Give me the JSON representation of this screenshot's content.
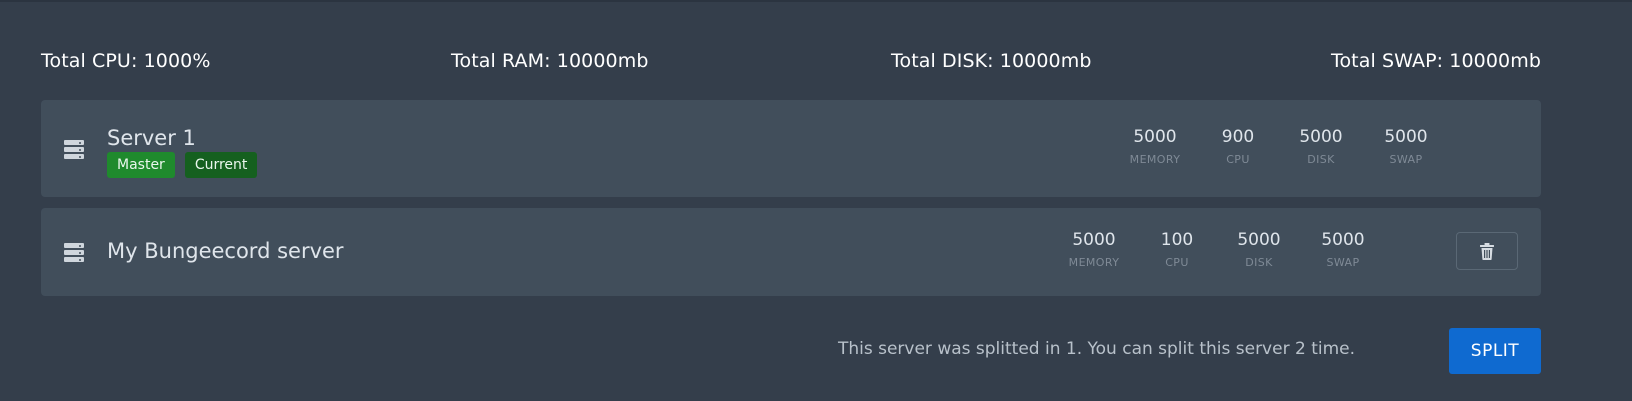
{
  "totals": {
    "cpu": "Total CPU: 1000%",
    "ram": "Total RAM: 10000mb",
    "disk": "Total DISK: 10000mb",
    "swap": "Total SWAP: 10000mb"
  },
  "servers": [
    {
      "name": "Server 1",
      "icon": "server-icon",
      "badges": {
        "master": "Master",
        "current": "Current"
      },
      "stats": [
        {
          "value": "5000",
          "label": "MEMORY"
        },
        {
          "value": "900",
          "label": "CPU"
        },
        {
          "value": "5000",
          "label": "DISK"
        },
        {
          "value": "5000",
          "label": "SWAP"
        }
      ]
    },
    {
      "name": "My Bungeecord server",
      "icon": "server-icon",
      "stats": [
        {
          "value": "5000",
          "label": "MEMORY"
        },
        {
          "value": "100",
          "label": "CPU"
        },
        {
          "value": "5000",
          "label": "DISK"
        },
        {
          "value": "5000",
          "label": "SWAP"
        }
      ],
      "delete_icon": "trash-icon"
    }
  ],
  "footer": {
    "split_text": "This server was splitted in 1. You can split this server 2 time.",
    "split_button": "SPLIT"
  },
  "colors": {
    "background": "#343e4b",
    "card": "#414e5b",
    "badge_master": "#1f8a2d",
    "badge_current": "#15601f",
    "primary_button": "#0f6ad0"
  }
}
